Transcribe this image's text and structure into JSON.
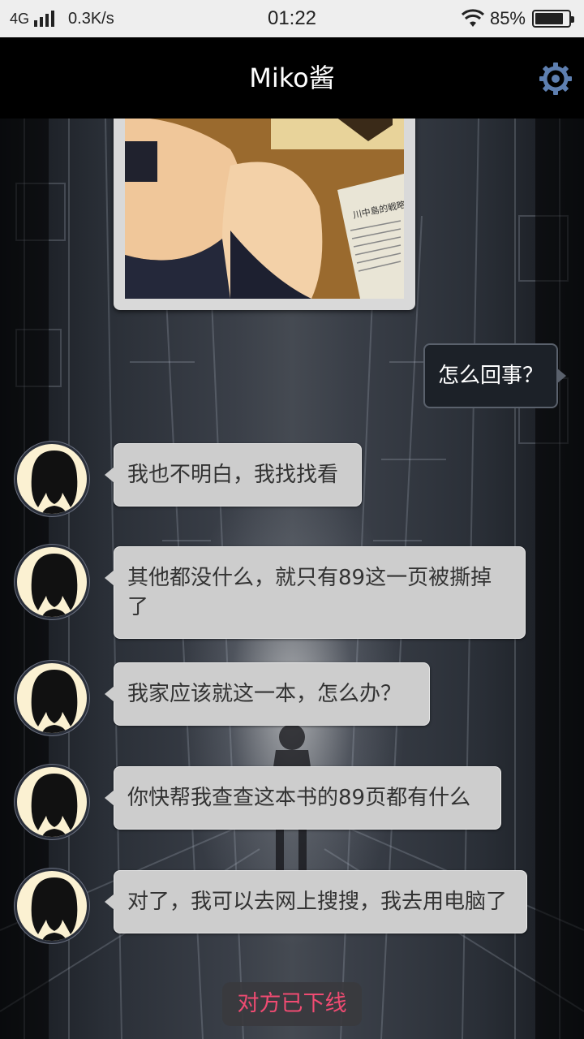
{
  "status_bar": {
    "network": "4G",
    "speed": "0.3K/s",
    "time": "01:22",
    "battery": "85%",
    "battery_level": 0.85
  },
  "header": {
    "title": "Miko酱",
    "settings_icon": "gear-icon",
    "accent_color": "#5e7fb0"
  },
  "chat": {
    "photo_text": "川中島的戦略分析",
    "outgoing": [
      {
        "text": "怎么回事？"
      }
    ],
    "incoming": [
      {
        "text": "我也不明白，我找找看"
      },
      {
        "text": "其他都没什么，就只有89这一页被撕掉了"
      },
      {
        "text": "我家应该就这一本，怎么办？"
      },
      {
        "text": "你快帮我查查这本书的89页都有什么"
      },
      {
        "text": "对了，我可以去网上搜搜，我去用电脑了"
      }
    ],
    "system_notice": "对方已下线"
  }
}
